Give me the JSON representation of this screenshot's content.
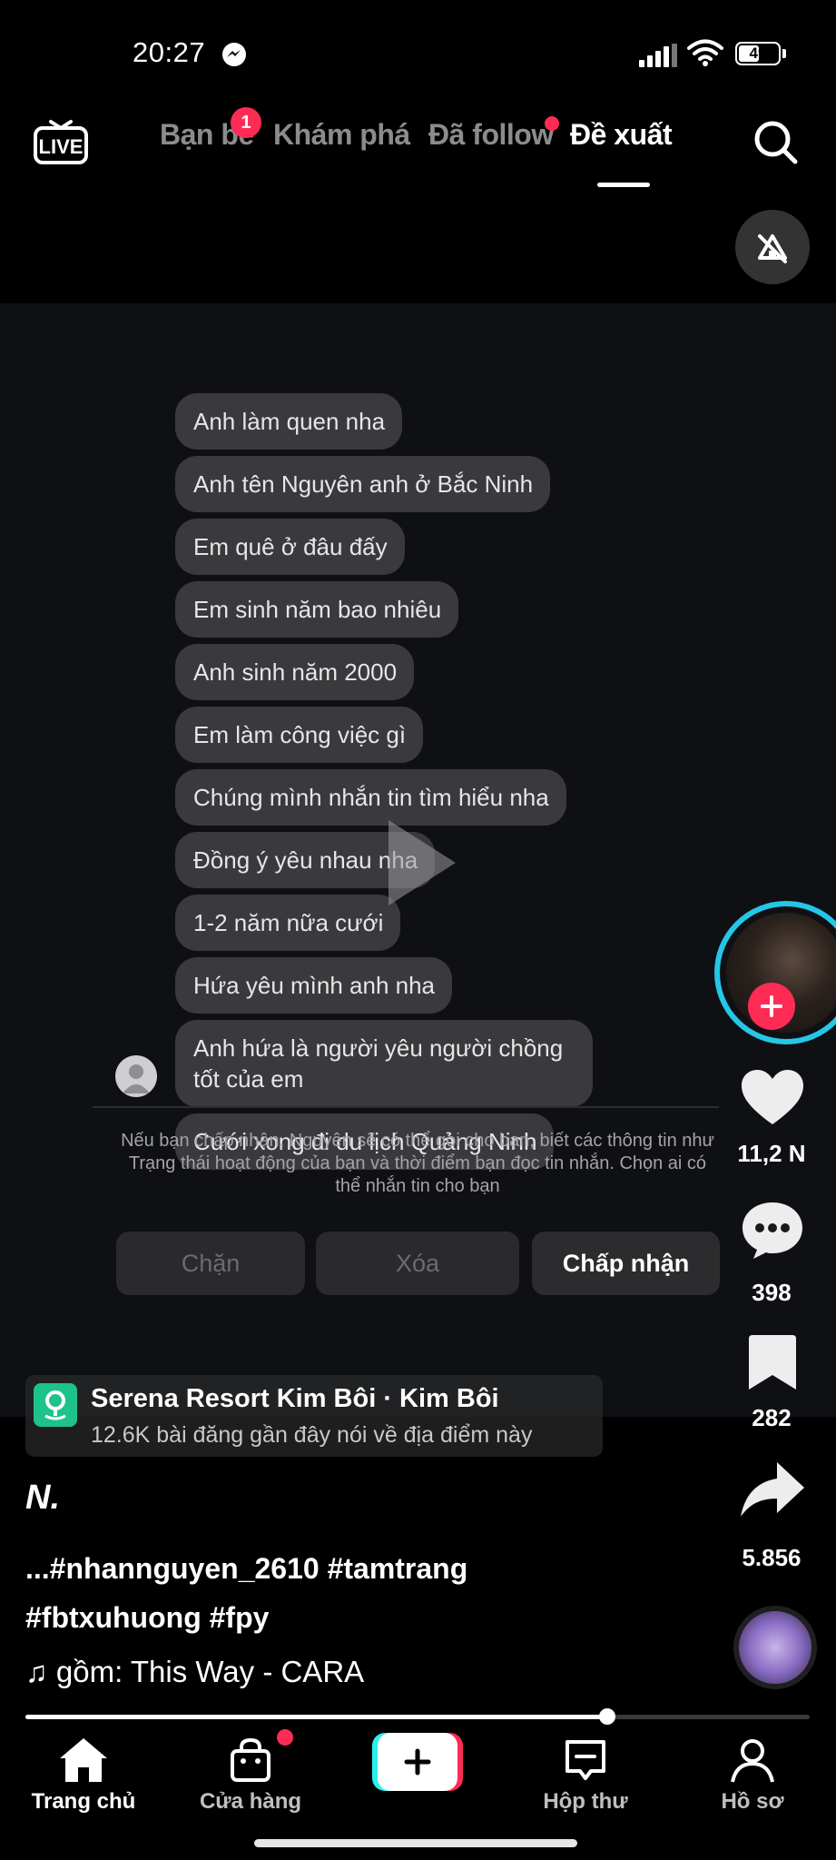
{
  "status_bar": {
    "time": "20:27",
    "battery": "49"
  },
  "top_nav": {
    "tabs": [
      "Bạn bè",
      "Khám phá",
      "Đã follow",
      "Đề xuất"
    ],
    "friends_badge": "1"
  },
  "chat": {
    "messages": [
      "Anh làm quen nha",
      "Anh tên Nguyên anh ở Bắc Ninh",
      "Em quê ở đâu đấy",
      "Em sinh năm bao nhiêu",
      "Anh sinh năm 2000",
      "Em làm công việc gì",
      "Chúng mình nhắn tin tìm hiểu nha",
      "Đồng ý yêu nhau nha",
      "1-2 năm nữa cưới",
      "Hứa yêu mình anh nha",
      "Anh hứa là người yêu người chồng tốt của em",
      "Cưới xong đi du lịch Quảng Ninh"
    ],
    "notice": "Nếu bạn chấp nhận, Nguyên sẽ có thể gọi cho bạn, biết các thông tin như Trạng thái hoạt động của bạn và thời điểm bạn đọc tin nhắn. Chọn ai có thể nhắn tin cho bạn",
    "buttons": {
      "block": "Chặn",
      "delete": "Xóa",
      "accept": "Chấp nhận"
    }
  },
  "rail": {
    "likes": "11,2 N",
    "comments": "398",
    "saves": "282",
    "shares": "5.856"
  },
  "location": {
    "title": "Serena Resort Kim Bôi · Kim Bôi",
    "subtitle": "12.6K bài đăng gần đây nói về địa điểm này"
  },
  "post": {
    "author": "N.",
    "caption": "...#nhannguyen_2610 #tamtrang #fbtxuhuong #fpy",
    "sound": "gồm: This Way - CARA",
    "progress": 0.62
  },
  "bottom_nav": {
    "home": "Trang chủ",
    "shop": "Cửa hàng",
    "inbox": "Hộp thư",
    "profile": "Hồ sơ"
  },
  "colors": {
    "accent": "#fe2c55",
    "ring": "#25c6e6",
    "location": "#1ec28b"
  }
}
